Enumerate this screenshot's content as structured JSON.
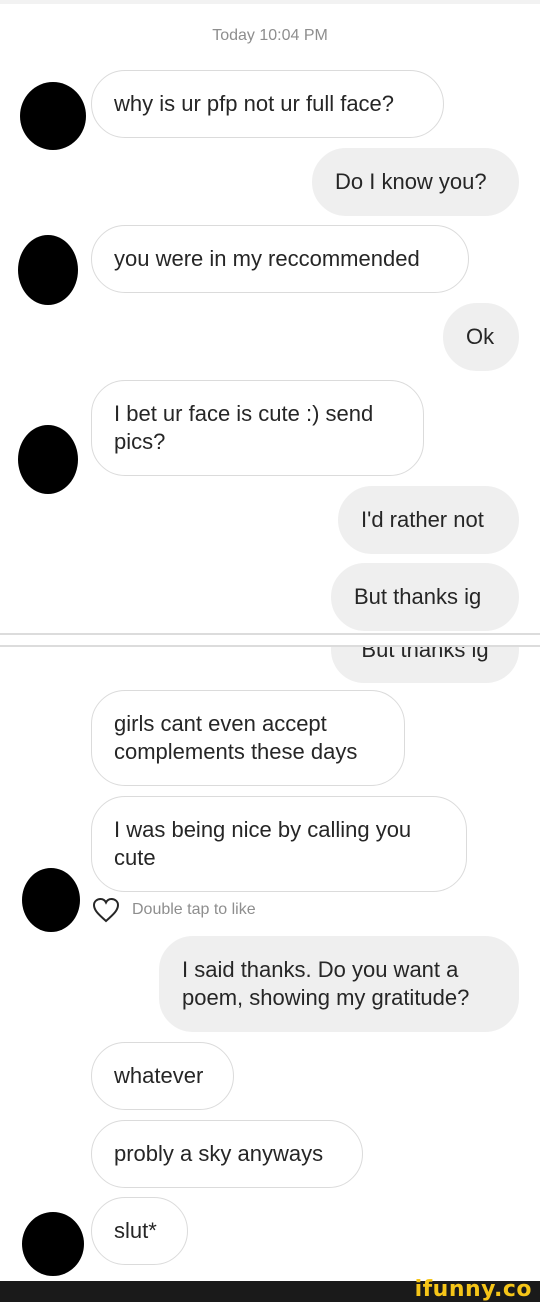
{
  "timestamp": "Today 10:04 PM",
  "messages": [
    {
      "side": "in",
      "text": "why is ur pfp not ur full face?"
    },
    {
      "side": "out",
      "text": "Do I know you?"
    },
    {
      "side": "in",
      "text": "you were in my reccommended"
    },
    {
      "side": "out",
      "text": "Ok"
    },
    {
      "side": "in",
      "text": "I bet ur face is cute :) send pics?"
    },
    {
      "side": "out",
      "text": "I'd rather not"
    },
    {
      "side": "out",
      "text": "But thanks ig"
    },
    {
      "side": "out",
      "text": "But thanks ig"
    },
    {
      "side": "in",
      "text": "girls cant even accept complements these days"
    },
    {
      "side": "in",
      "text": "I was being nice by calling you cute"
    },
    {
      "side": "out",
      "text": "I said thanks. Do you want a poem, showing my gratitude?"
    },
    {
      "side": "in",
      "text": "whatever"
    },
    {
      "side": "in",
      "text": "probly a sky anyways"
    },
    {
      "side": "in",
      "text": "slut*"
    }
  ],
  "like_hint": "Double tap to like",
  "icons": {
    "like": "heart-icon",
    "avatar": "avatar-blob"
  },
  "watermark": "ifunny.co",
  "colors": {
    "incoming_border": "#dbdbdb",
    "outgoing_bg": "#efefef",
    "muted": "#8e8e8e",
    "watermark": "#f5c518"
  }
}
